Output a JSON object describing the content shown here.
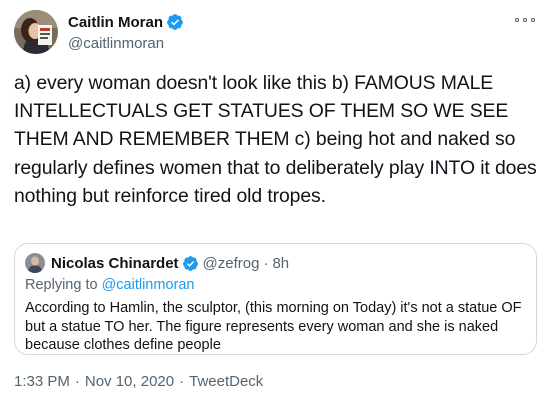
{
  "author": {
    "name": "Caitlin Moran",
    "handle": "@caitlinmoran",
    "avatar_icon": "profile-photo",
    "verified": true
  },
  "tweet": {
    "text": "a) every woman doesn't look like this b) FAMOUS MALE INTELLECTUALS GET STATUES OF THEM SO WE SEE THEM AND REMEMBER THEM c) being hot and naked so regularly defines women that to deliberately play INTO it does nothing but reinforce tired old tropes."
  },
  "quoted": {
    "name": "Nicolas Chinardet",
    "handle": "@zefrog",
    "dot": "·",
    "time": "8h",
    "replying_prefix": "Replying to",
    "replying_to": "@caitlinmoran",
    "text": "According to Hamlin, the sculptor, (this morning on Today) it's not a statue OF but a statue TO her. The figure represents every woman and she is naked because clothes define people"
  },
  "meta": {
    "time": "1:33 PM",
    "date": "Nov 10, 2020",
    "client": "TweetDeck",
    "sep": "·"
  },
  "colors": {
    "verified": "#1d9bf0",
    "secondary_text": "#536471",
    "link": "#1d9bf0",
    "border": "#cfd9de"
  }
}
